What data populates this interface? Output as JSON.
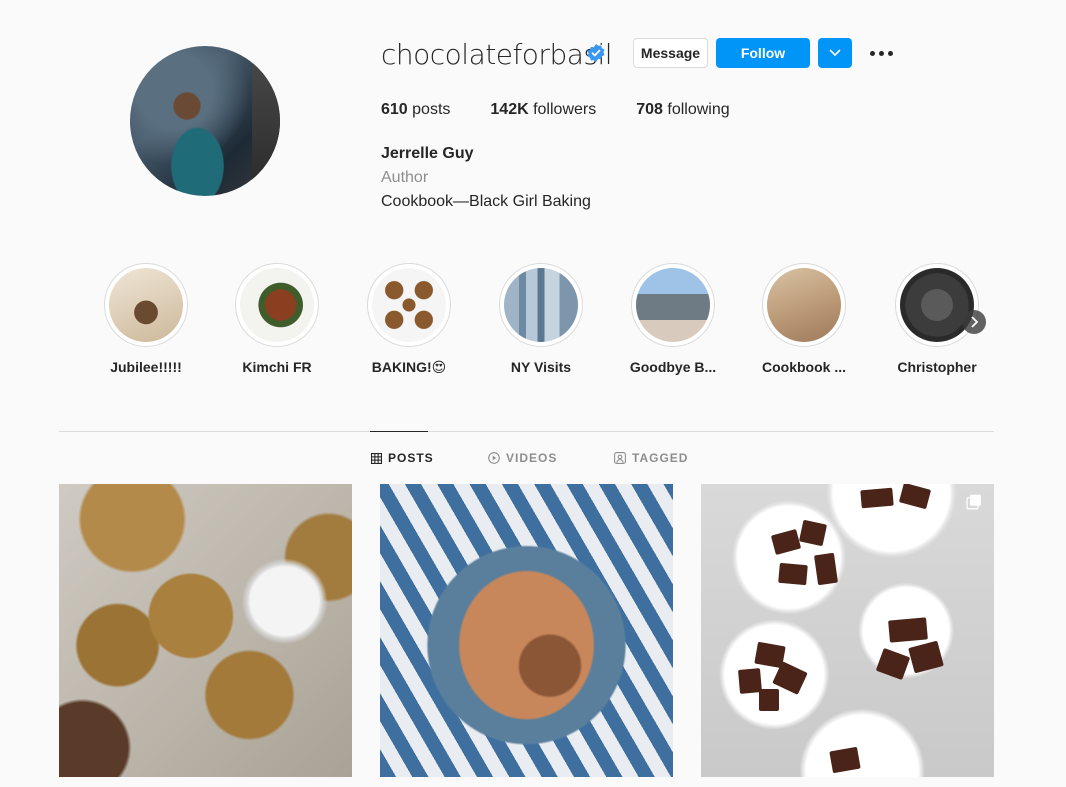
{
  "profile": {
    "username": "chocolateforbasil",
    "verified": true,
    "buttons": {
      "message": "Message",
      "follow": "Follow"
    },
    "stats": {
      "posts_count": "610",
      "posts_label": " posts",
      "followers_count": "142K",
      "followers_label": " followers",
      "following_count": "708",
      "following_label": " following"
    },
    "full_name": "Jerrelle Guy",
    "category": "Author",
    "bio": "Cookbook—Black Girl Baking"
  },
  "highlights": [
    {
      "label": "Jubilee!!!!!"
    },
    {
      "label": "Kimchi FR"
    },
    {
      "label": "BAKING!😍"
    },
    {
      "label": "NY Visits"
    },
    {
      "label": "Goodbye B..."
    },
    {
      "label": "Cookbook ..."
    },
    {
      "label": "Christopher"
    }
  ],
  "tabs": [
    {
      "label": "POSTS",
      "icon": "grid-icon",
      "active": true
    },
    {
      "label": "VIDEOS",
      "icon": "play-icon",
      "active": false
    },
    {
      "label": "TAGGED",
      "icon": "tag-icon",
      "active": false
    }
  ],
  "colors": {
    "accent": "#0095f6",
    "text": "#262626",
    "muted": "#8e8e8e",
    "border": "#dbdbdb"
  }
}
